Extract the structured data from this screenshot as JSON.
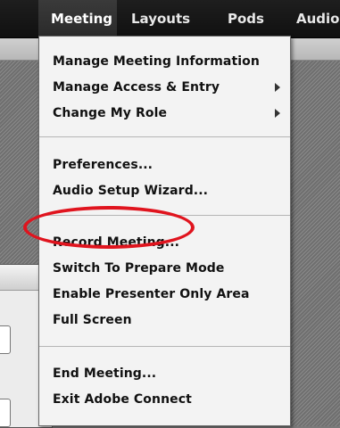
{
  "menubar": {
    "items": [
      {
        "label": "Meeting",
        "active": true
      },
      {
        "label": "Layouts",
        "active": false
      },
      {
        "label": "Pods",
        "active": false
      },
      {
        "label": "Audio",
        "active": false
      }
    ]
  },
  "menu": {
    "group1": [
      {
        "label": "Manage Meeting Information",
        "submenu": false
      },
      {
        "label": "Manage Access & Entry",
        "submenu": true
      },
      {
        "label": "Change My Role",
        "submenu": true
      }
    ],
    "group2": [
      {
        "label": "Preferences..."
      },
      {
        "label": "Audio Setup Wizard..."
      }
    ],
    "group3": [
      {
        "label": "Record Meeting..."
      },
      {
        "label": "Switch To Prepare Mode"
      },
      {
        "label": "Enable Presenter Only Area"
      },
      {
        "label": "Full Screen"
      }
    ],
    "group4": [
      {
        "label": "End Meeting..."
      },
      {
        "label": "Exit Adobe Connect"
      }
    ]
  },
  "annotation": {
    "highlight_color": "#e0141e",
    "highlighted_item": "Record Meeting..."
  }
}
